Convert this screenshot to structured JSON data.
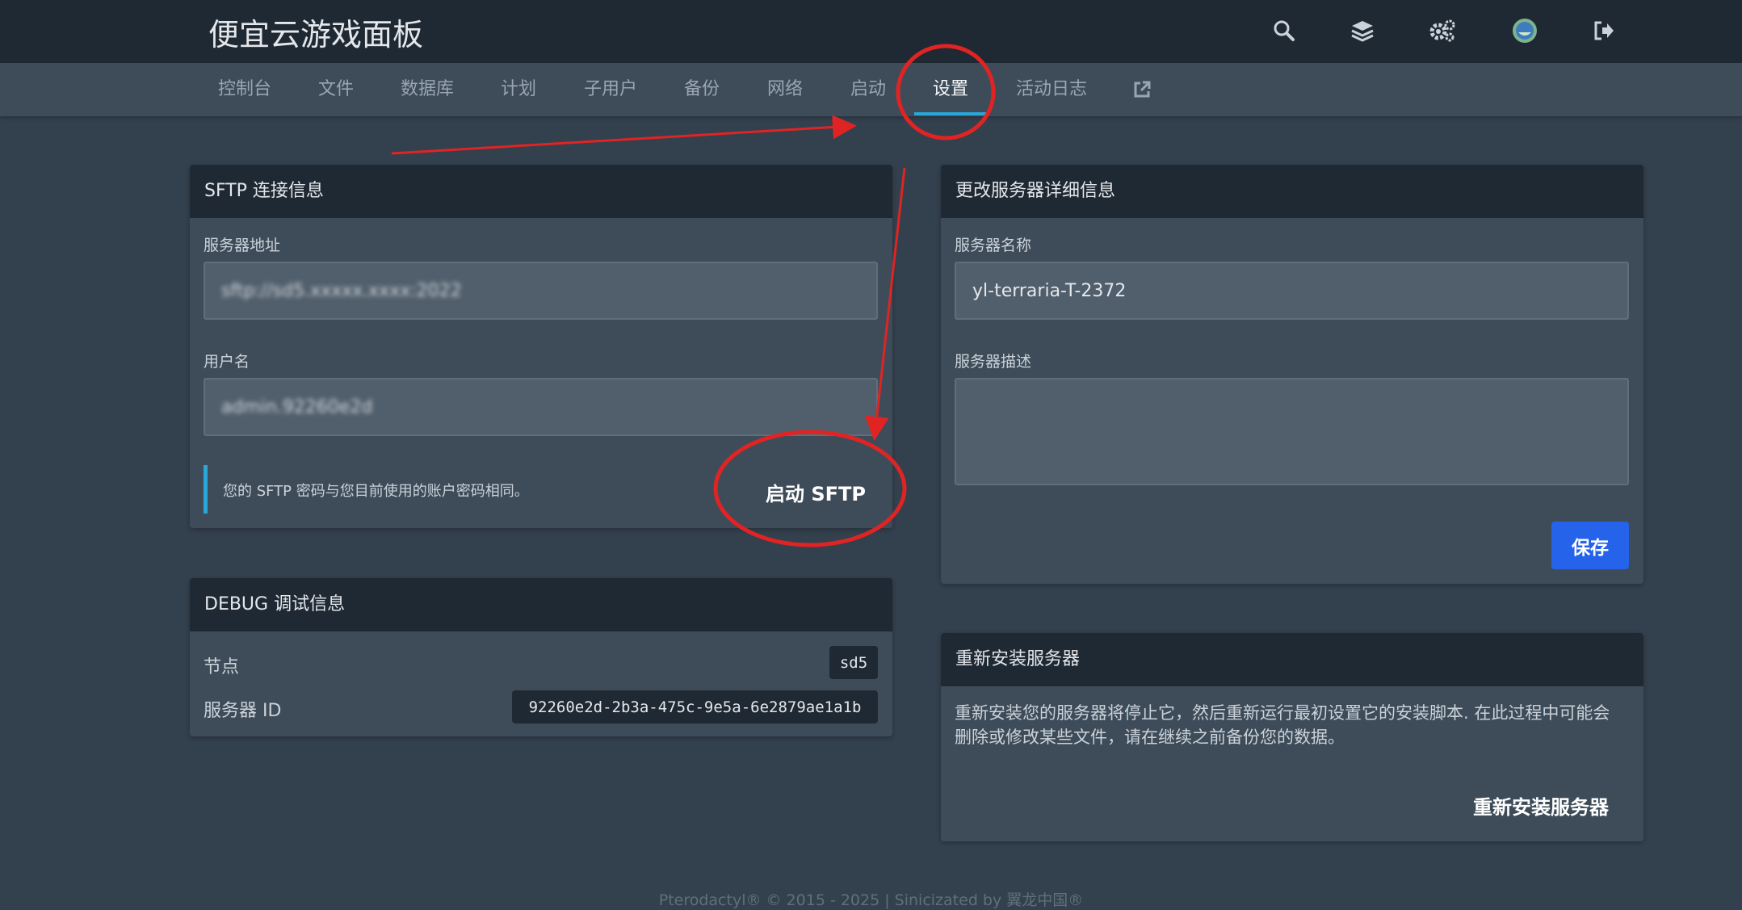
{
  "header": {
    "title": "便宜云游戏面板",
    "icons": [
      "search-icon",
      "layers-icon",
      "settings-gears-icon",
      "avatar",
      "logout-icon"
    ]
  },
  "nav": {
    "tabs": [
      {
        "label": "控制台"
      },
      {
        "label": "文件"
      },
      {
        "label": "数据库"
      },
      {
        "label": "计划"
      },
      {
        "label": "子用户"
      },
      {
        "label": "备份"
      },
      {
        "label": "网络"
      },
      {
        "label": "启动"
      },
      {
        "label": "设置"
      },
      {
        "label": "活动日志"
      }
    ],
    "active_tab": "设置",
    "external_icon": "external-link-icon"
  },
  "sftp": {
    "title": "SFTP 连接信息",
    "address_label": "服务器地址",
    "address_value": "sftp://sd5.xxxxx.xxxx:2022",
    "username_label": "用户名",
    "username_value": "admin.92260e2d",
    "note": "您的 SFTP 密码与您目前使用的账户密码相同。",
    "launch_label": "启动 SFTP"
  },
  "debug": {
    "title": "DEBUG 调试信息",
    "node_label": "节点",
    "node_value": "sd5",
    "server_id_label": "服务器 ID",
    "server_id_value": "92260e2d-2b3a-475c-9e5a-6e2879ae1a1b"
  },
  "details": {
    "title": "更改服务器详细信息",
    "name_label": "服务器名称",
    "name_value": "yl-terraria-T-2372",
    "desc_label": "服务器描述",
    "desc_value": "",
    "save_label": "保存"
  },
  "reinstall": {
    "title": "重新安装服务器",
    "text_line1": "重新安装您的服务器将停止它，然后重新运行最初设置它的安装脚本. 在此过程中可能会",
    "text_line2": "删除或修改某些文件，请在继续之前备份您的数据。",
    "button_label": "重新安装服务器"
  },
  "footer": {
    "text": "Pterodactyl® © 2015 - 2025 | Sinicizated by 翼龙中国®"
  },
  "colors": {
    "background": "#33404d",
    "header": "#1f2933",
    "card": "#3e4c59",
    "accent": "#2ba6d9",
    "primary_button": "#2563eb",
    "annotation": "#e02424"
  }
}
